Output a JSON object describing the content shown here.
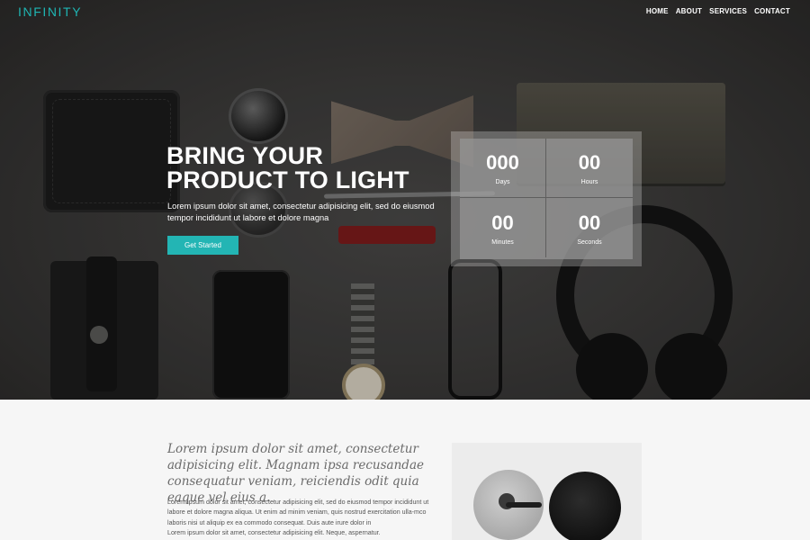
{
  "header": {
    "logo": "INFINITY",
    "nav": [
      "HOME",
      "ABOUT",
      "SERVICES",
      "CONTACT"
    ]
  },
  "hero": {
    "title": "BRING YOUR PRODUCT TO LIGHT",
    "text": "Lorem ipsum dolor sit amet, consectetur adipisicing elit, sed do eiusmod tempor incididunt ut labore et dolore magna",
    "cta": "Get Started"
  },
  "countdown": {
    "days": {
      "value": "000",
      "label": "Days"
    },
    "hours": {
      "value": "00",
      "label": "Hours"
    },
    "minutes": {
      "value": "00",
      "label": "Minutes"
    },
    "seconds": {
      "value": "00",
      "label": "Seconds"
    }
  },
  "about": {
    "quote": "Lorem ipsum dolor sit amet, consectetur adipisicing elit. Magnam ipsa recusandae consequatur veniam, reiciendis odit quia eaque vel eius a.",
    "body": "Lorem ipsum dolor sit amet, consectetur adipisicing elit, sed do eiusmod tempor incididunt ut labore et dolore magna aliqua. Ut enim ad minim veniam, quis nostrud exercitation ulla-mco laboris nisi ut aliquip ex ea commodo consequat. Duis aute irure dolor in",
    "body2": "Lorem ipsum dolor sit amet, consectetur adipisicing elit. Neque, aspernatur."
  },
  "colors": {
    "accent": "#23b5b4",
    "hero_bg": "#3a3938",
    "section_bg": "#f6f6f6"
  }
}
